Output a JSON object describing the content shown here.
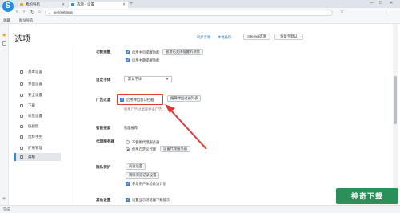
{
  "browser": {
    "logo": "S",
    "tabs": [
      {
        "label": "我的导航",
        "favicon_color": "#f2a300"
      },
      {
        "label": "选项 - 设置",
        "favicon_color": "#1f8ff0"
      }
    ],
    "new_tab": "+",
    "window_controls": [
      "—",
      "☐",
      "✕"
    ],
    "address": {
      "secure_icon": "✓",
      "value": "se://settings"
    },
    "nav": {
      "back": "‹",
      "forward": "›",
      "reload": "↻",
      "home": "⌂"
    },
    "toolbar_right": [
      "☆",
      "⋮"
    ],
    "bookmarks": [
      "收藏",
      "网址导航"
    ]
  },
  "page": {
    "title": "选项",
    "header_links": [
      "同步云端",
      "本地备份"
    ],
    "header_buttons": [
      "Internet选项",
      "恢复至默认"
    ]
  },
  "sidebar": {
    "items": [
      {
        "label": "基本设置"
      },
      {
        "label": "界面设置"
      },
      {
        "label": "安全设置"
      },
      {
        "label": "下载"
      },
      {
        "label": "标签设置"
      },
      {
        "label": "快捷键"
      },
      {
        "label": "鼠标手势"
      },
      {
        "label": "扩展管理"
      },
      {
        "label": "高级"
      }
    ],
    "active_index": 8
  },
  "settings": {
    "func_prompt": {
      "label": "功能提醒",
      "option1": "启用主页提醒功能",
      "button": "管理已关闭提醒的项目",
      "option2": "启用主题提醒功能"
    },
    "font": {
      "label": "自定字体",
      "select_value": "默认字体"
    },
    "ad_filter": {
      "label": "广告过滤",
      "checkbox": "启用弹出窗口拦截",
      "button": "编辑弹出过滤列表",
      "hint": "使用广告过滤或更多广告..."
    },
    "smart_suggest": {
      "label": "智能搜索",
      "value": "智能推荐"
    },
    "proxy": {
      "label": "代理服务器",
      "option1": "不使用代理服务器",
      "option2": "使用自定义代理",
      "button": "设置代理服务器"
    },
    "privacy": {
      "label": "隐私保护",
      "button1": "内容设置",
      "button2": "清除浏览记录设置",
      "option": "参与用户体验改进计划"
    },
    "bottom": {
      "label": "其他设置",
      "option": "设置显示浏览器下载提示"
    }
  },
  "status": {
    "text": "完成"
  },
  "watermark": "神奇下载",
  "colors": {
    "accent": "#1f8ff0",
    "highlight": "#e03b3b",
    "watermark_bg": "#2b8f5a"
  }
}
